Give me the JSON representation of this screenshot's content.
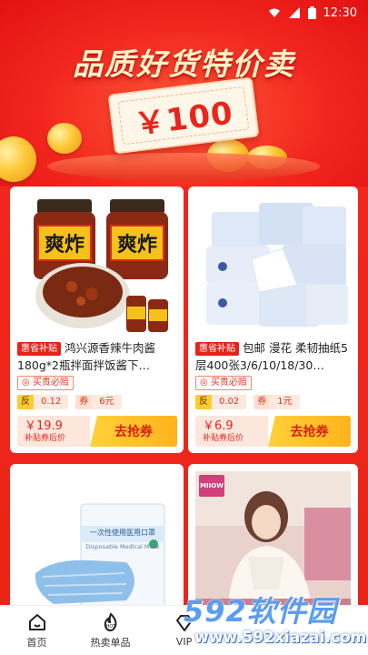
{
  "status_bar": {
    "time": "12:30"
  },
  "hero": {
    "title": "品质好货特价卖",
    "coupon_value": "￥100"
  },
  "products": [
    {
      "subsidy_tag": "惠省补贴",
      "title": "鸿兴源香辣牛肉酱180g*2瓶拌面拌饭酱下…",
      "image_label": "爽炸",
      "must_buy": "买贵必赔",
      "rebate_key": "反",
      "rebate_value": "0.12",
      "coupon_key": "券",
      "coupon_value": "6元",
      "price": "￥19.9",
      "price_note": "补贴券后价",
      "grab_label": "去抢券"
    },
    {
      "subsidy_tag": "惠省补贴",
      "title": "包邮 漫花 柔韧抽纸5层400张3/6/10/18/30…",
      "image_label": "",
      "must_buy": "买贵必赔",
      "rebate_key": "反",
      "rebate_value": "0.02",
      "coupon_key": "券",
      "coupon_value": "1元",
      "price": "￥6.9",
      "price_note": "补贴券后价",
      "grab_label": "去抢券"
    },
    {
      "image_label": "一次性使用医用口罩",
      "image_sublabel": "Disposable Medical Mask"
    },
    {
      "image_label": "MIIOW"
    }
  ],
  "bottom_nav": [
    {
      "label": "首页",
      "icon": "home-icon"
    },
    {
      "label": "热卖单品",
      "icon": "hot-icon"
    },
    {
      "label": "VIP",
      "icon": "vip-icon"
    },
    {
      "label": "",
      "icon": ""
    },
    {
      "label": "",
      "icon": ""
    }
  ],
  "watermark": {
    "brand": "592软件园",
    "url": "www.592xiazai.com"
  },
  "colors": {
    "primary_red": "#f2261e",
    "gold": "#ffc93a",
    "accent_yellow": "#ffb41c"
  }
}
